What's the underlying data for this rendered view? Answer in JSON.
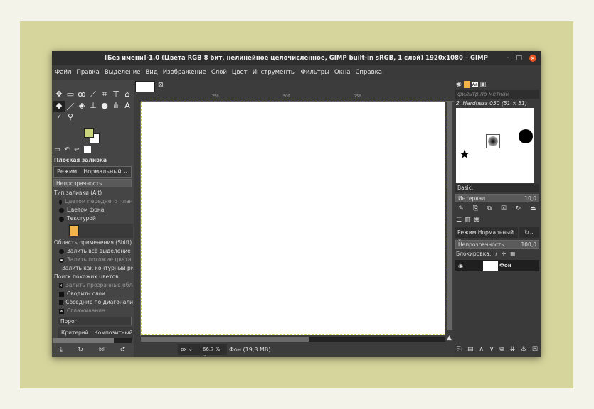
{
  "window": {
    "title": "[Без имени]-1.0 (Цвета RGB 8 бит, нелинейное целочисленное, GIMP built-in sRGB, 1 слой) 1920x1080 – GIMP",
    "minimize": "–",
    "maximize": "□",
    "close": "×"
  },
  "menu": [
    "Файл",
    "Правка",
    "Выделение",
    "Вид",
    "Изображение",
    "Слой",
    "Цвет",
    "Инструменты",
    "Фильтры",
    "Окна",
    "Справка"
  ],
  "colors": {
    "foreground": "#c9d37e",
    "background": "#ffffff",
    "accent": "#e95420"
  },
  "tool_options": {
    "title": "Плоская заливка",
    "mode_label": "Режим",
    "mode_value": "Нормальный",
    "opacity_label": "Непрозрачность",
    "fill_type_label": "Тип заливки (Alt)",
    "fill_types": [
      "Цветом переднего плана",
      "Цветом фона",
      "Текстурой"
    ],
    "area_label": "Область применения (Shift)",
    "areas": [
      "Залить всё выделение",
      "Залить похожие цвета",
      "Залить как контурный рисунок"
    ],
    "similar_label": "Поиск похожих цветов",
    "similar_opts": [
      "Залить прозрачные области",
      "Сводить слои",
      "Соседние по диагонали",
      "Сглаживание"
    ],
    "threshold_label": "Порог",
    "criterion_label": "Критерий",
    "criterion_value": "Композитный цвет"
  },
  "ruler": [
    "250",
    "500",
    "750"
  ],
  "status": {
    "unit": "px",
    "zoom": "66,7 %",
    "info": "Фон (19,3 MB)"
  },
  "brushes": {
    "filter_placeholder": "фильтр по меткам",
    "selected": "2. Hardness 050 (51 × 51)",
    "tag": "Basic,",
    "spacing_label": "Интервал",
    "spacing_value": "10,0"
  },
  "layers": {
    "mode": "Режим Нормальный",
    "opacity_label": "Непрозрачность",
    "opacity_value": "100,0",
    "lock_label": "Блокировка:",
    "items": [
      {
        "name": "Фон"
      }
    ]
  }
}
